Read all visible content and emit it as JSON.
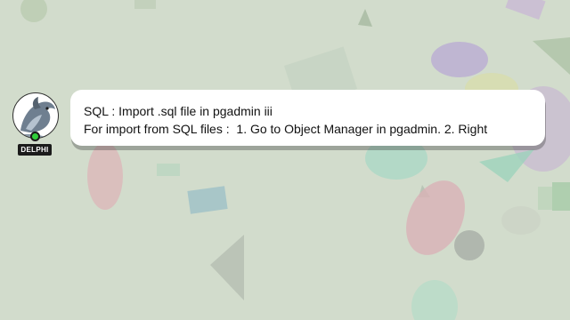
{
  "avatar": {
    "name_tag": "DELPHI",
    "icon": "dolphin-logo-icon",
    "status_color": "#2fcf3a"
  },
  "message": {
    "line1": "SQL : Import .sql file in pgadmin iii",
    "line2": "For import from SQL files :  1. Go to Object Manager in pgadmin. 2. Right"
  },
  "colors": {
    "background": "#d2dccc",
    "bubble": "#ffffff",
    "text": "#111111"
  }
}
